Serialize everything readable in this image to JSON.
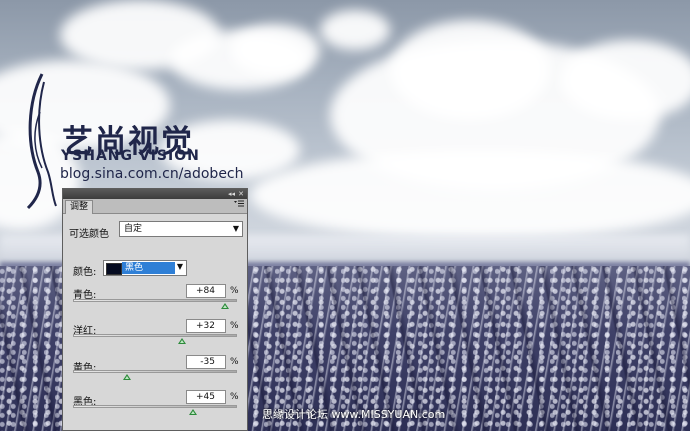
{
  "watermark": {
    "brand_cn": "艺尚视觉",
    "brand_en": "YSHANG VISION",
    "url": "blog.sina.com.cn/adobech",
    "footer": "思缘设计论坛  www.MISSYUAN.com"
  },
  "panel": {
    "tab_label": "调整",
    "bar_collapse": "◂◂",
    "bar_close": "✕",
    "menu_icon": "panel-menu-icon",
    "adjustment_label": "可选颜色",
    "preset_value": "自定",
    "colors_label": "颜色:",
    "colors_value": "黑色",
    "colors_swatch": "#050b20",
    "sliders": [
      {
        "label": "青色:",
        "value": "+84",
        "unit": "%"
      },
      {
        "label": "洋红:",
        "value": "+32",
        "unit": "%"
      },
      {
        "label": "黄色:",
        "value": "-35",
        "unit": "%"
      },
      {
        "label": "黑色:",
        "value": "+45",
        "unit": "%"
      }
    ]
  },
  "colors": {
    "panel_bg": "#d7d7d7",
    "selected_item": "#2f7fd6",
    "slider_thumb": "#2c8a3a",
    "logo_ink": "#20264a"
  }
}
